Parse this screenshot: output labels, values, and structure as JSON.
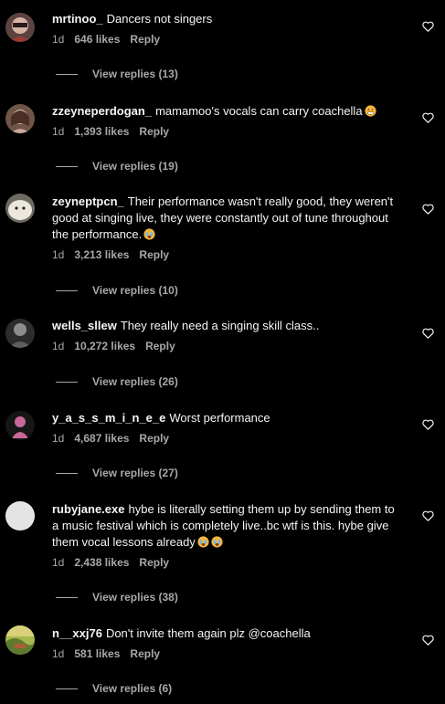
{
  "colors": {
    "background": "#000000",
    "text": "#f5f5f5",
    "secondary": "#a8a8a8"
  },
  "comments": [
    {
      "username": "mrtinoo_",
      "text": "Dancers not singers",
      "emoji": [],
      "time": "1d",
      "likes": "646 likes",
      "reply": "Reply",
      "view_replies": "View replies (13)",
      "avatar": "person-glasses-avatar",
      "avatar_color": "#6b4b46"
    },
    {
      "username": "zzeyneperdogan_",
      "text": "mamamoo's vocals can carry coachella",
      "emoji": [
        "grimacing-face"
      ],
      "time": "1d",
      "likes": "1,393 likes",
      "reply": "Reply",
      "view_replies": "View replies (19)",
      "avatar": "person-portrait-avatar",
      "avatar_color": "#8c6a5c"
    },
    {
      "username": "zeyneptpcn_",
      "text": "Their performance wasn't really good, they weren't good at singing live, they were constantly out of tune throughout the performance.",
      "emoji": [
        "crying-face"
      ],
      "time": "1d",
      "likes": "3,213 likes",
      "reply": "Reply",
      "view_replies": "View replies (10)",
      "avatar": "white-pet-avatar",
      "avatar_color": "#d9d4cc"
    },
    {
      "username": "wells_sllew",
      "text": "They really need a singing skill class..",
      "emoji": [],
      "time": "1d",
      "likes": "10,272 likes",
      "reply": "Reply",
      "view_replies": "View replies (26)",
      "avatar": "person-dark-avatar",
      "avatar_color": "#3a3a3a"
    },
    {
      "username": "y_a_s_s_m_i_n_e_e",
      "text": "Worst performance",
      "emoji": [],
      "time": "1d",
      "likes": "4,687 likes",
      "reply": "Reply",
      "view_replies": "View replies (27)",
      "avatar": "pink-figure-avatar",
      "avatar_color": "#1a1a1a"
    },
    {
      "username": "rubyjane.exe",
      "text": "hybe is literally setting them up by sending them to a music festival which is completely live..bc wtf is this. hybe give them vocal lessons already",
      "emoji": [
        "crying-face",
        "crying-face"
      ],
      "time": "1d",
      "likes": "2,438 likes",
      "reply": "Reply",
      "view_replies": "View replies (38)",
      "avatar": "default-blank-avatar",
      "avatar_color": "#e8e8e8"
    },
    {
      "username": "n__xxj76",
      "text": "Don't invite them again plz @coachella",
      "emoji": [],
      "time": "1d",
      "likes": "581 likes",
      "reply": "Reply",
      "view_replies": "View replies (6)",
      "avatar": "landscape-avatar",
      "avatar_color": "#7a8b3a"
    }
  ]
}
